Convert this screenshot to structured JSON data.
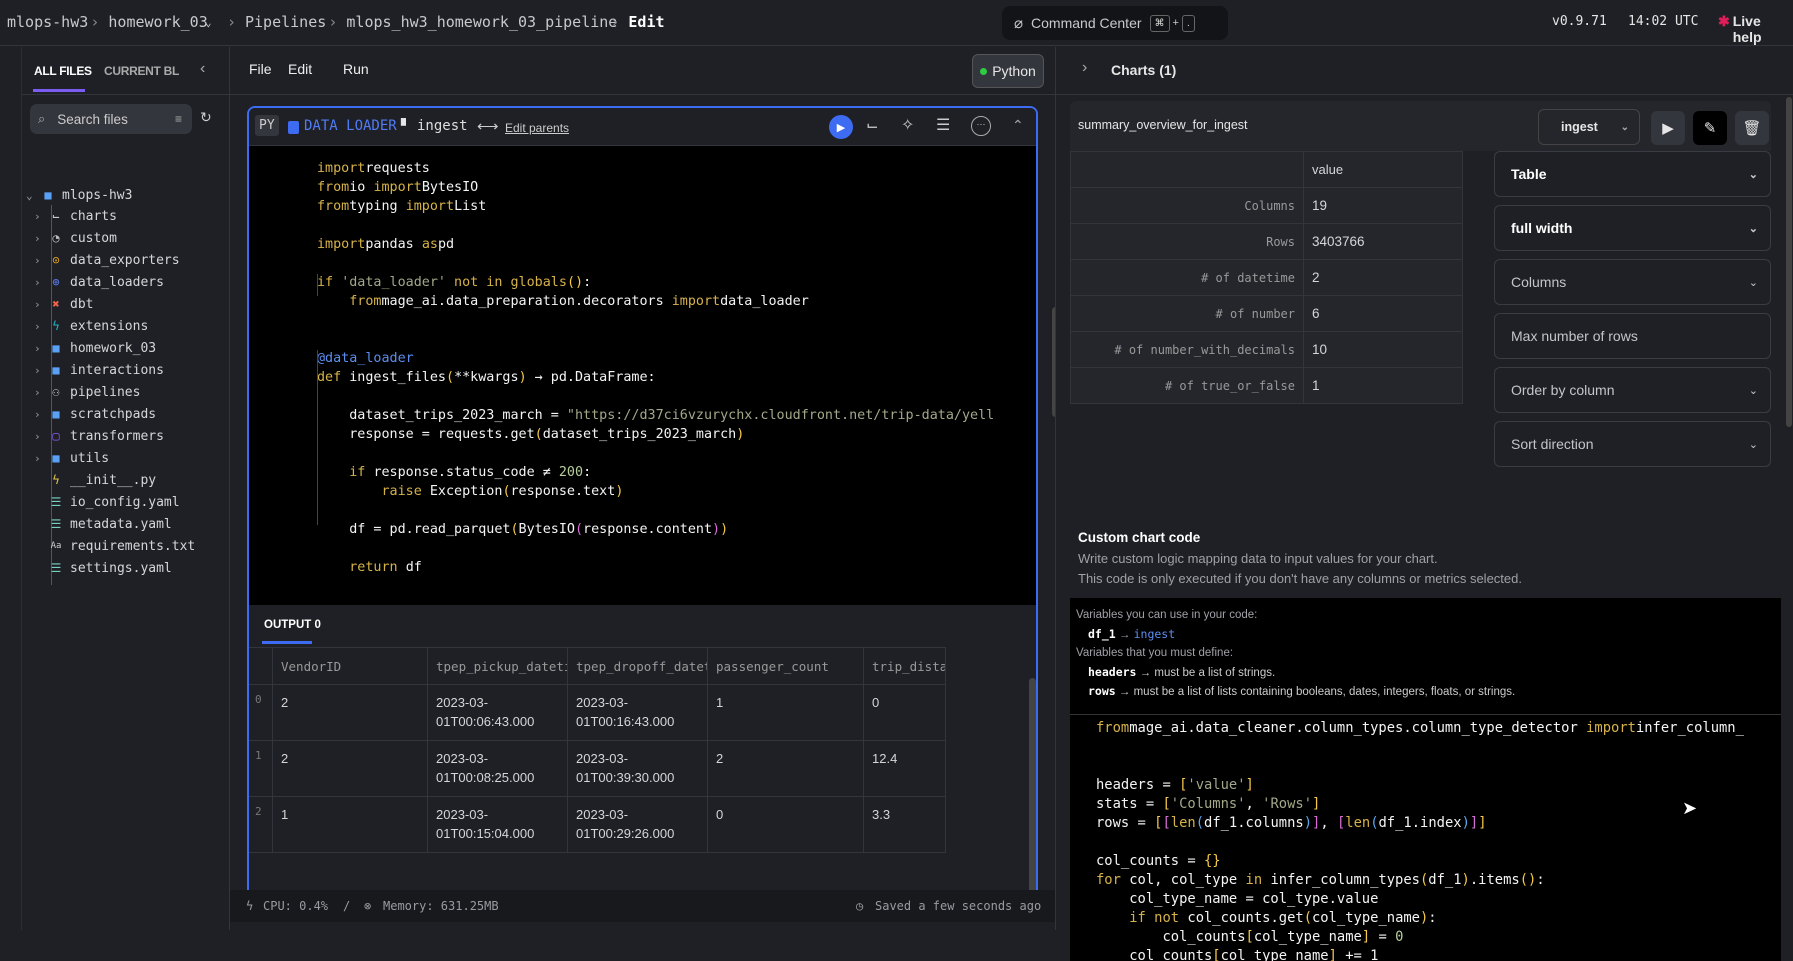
{
  "breadcrumb": [
    "mlops-hw3",
    "homework_03",
    "Pipelines",
    "mlops_hw3_homework_03_pipeline",
    "Edit"
  ],
  "command_center": {
    "label": "Command Center",
    "key1": "⌘",
    "plus": "+",
    "key2": "."
  },
  "version": "v0.9.71",
  "time": "14:02 UTC",
  "live_help": "Live help",
  "files": {
    "tabs": [
      "ALL FILES",
      "CURRENT BLOCK"
    ],
    "search_placeholder": "Search files",
    "root": "mlops-hw3",
    "items": [
      {
        "name": "charts",
        "icon": "chart-icon",
        "folder": true
      },
      {
        "name": "custom",
        "icon": "custom-icon",
        "folder": true
      },
      {
        "name": "data_exporters",
        "icon": "exporter-icon",
        "folder": true
      },
      {
        "name": "data_loaders",
        "icon": "loader-icon",
        "folder": true
      },
      {
        "name": "dbt",
        "icon": "dbt-icon",
        "folder": true
      },
      {
        "name": "extensions",
        "icon": "bolt-icon",
        "folder": true
      },
      {
        "name": "homework_03",
        "icon": "folder-icon",
        "folder": true
      },
      {
        "name": "interactions",
        "icon": "folder-icon",
        "folder": true
      },
      {
        "name": "pipelines",
        "icon": "pipeline-icon",
        "folder": true
      },
      {
        "name": "scratchpads",
        "icon": "folder-icon",
        "folder": true
      },
      {
        "name": "transformers",
        "icon": "transformer-icon",
        "folder": true
      },
      {
        "name": "utils",
        "icon": "folder-icon",
        "folder": true
      },
      {
        "name": "__init__.py",
        "icon": "python-icon",
        "folder": false
      },
      {
        "name": "io_config.yaml",
        "icon": "list-icon",
        "folder": false
      },
      {
        "name": "metadata.yaml",
        "icon": "list-icon",
        "folder": false
      },
      {
        "name": "requirements.txt",
        "icon": "text-icon",
        "folder": false
      },
      {
        "name": "settings.yaml",
        "icon": "list-icon",
        "folder": false
      }
    ]
  },
  "menu": [
    "File",
    "Edit",
    "Run"
  ],
  "kernel": "Python",
  "block": {
    "lang": "PY",
    "type": "DATA LOADER",
    "name": "ingest",
    "edit_parents": "Edit parents",
    "code": [
      [
        [
          "kw",
          "import"
        ],
        [
          "",
          "requests"
        ]
      ],
      [
        [
          "kw",
          "from"
        ],
        [
          "",
          "io "
        ],
        [
          "kw",
          "import"
        ],
        [
          "",
          "BytesIO"
        ]
      ],
      [
        [
          "kw",
          "from"
        ],
        [
          "",
          "typing "
        ],
        [
          "kw",
          "import"
        ],
        [
          "",
          "List"
        ]
      ],
      [],
      [
        [
          "kw",
          "import"
        ],
        [
          "",
          "pandas "
        ],
        [
          "kw",
          "as"
        ],
        [
          "",
          "pd"
        ]
      ],
      [],
      [
        [
          "kw",
          "if "
        ],
        [
          "str",
          "'data_loader'"
        ],
        [
          "kw",
          " not in "
        ],
        [
          "kw",
          "globals"
        ],
        [
          "br1",
          "()"
        ],
        [
          "",
          ":"
        ]
      ],
      [
        [
          "",
          "    "
        ],
        [
          "kw",
          "from"
        ],
        [
          "",
          "mage_ai.data_preparation.decorators "
        ],
        [
          "kw",
          "import"
        ],
        [
          "",
          "data_loader"
        ]
      ],
      [],
      [],
      [
        [
          "deco",
          "@data_loader"
        ]
      ],
      [
        [
          "kw",
          "def "
        ],
        [
          "",
          "ingest_files"
        ],
        [
          "br1",
          "("
        ],
        [
          "",
          "**kwargs"
        ],
        [
          "br1",
          ")"
        ],
        [
          "",
          "",
          " → pd.DataFrame:"
        ]
      ],
      [],
      [
        [
          "",
          "    dataset_trips_2023_march = "
        ],
        [
          "str",
          "\"https://d37ci6vzurychx.cloudfront.net/trip-data/yell"
        ]
      ],
      [
        [
          "",
          "    response = requests.get"
        ],
        [
          "br1",
          "("
        ],
        [
          "",
          "dataset_trips_2023_march"
        ],
        [
          "br1",
          ")"
        ]
      ],
      [],
      [
        [
          "",
          "    "
        ],
        [
          "kw",
          "if "
        ],
        [
          "",
          "response.status_code ≠ "
        ],
        [
          "num",
          "200"
        ],
        [
          "",
          ":"
        ]
      ],
      [
        [
          "",
          "        "
        ],
        [
          "kw",
          "raise "
        ],
        [
          "",
          "Exception"
        ],
        [
          "br1",
          "("
        ],
        [
          "",
          "response.text"
        ],
        [
          "br1",
          ")"
        ]
      ],
      [],
      [
        [
          "",
          "    df = pd.read_parquet"
        ],
        [
          "br1",
          "("
        ],
        [
          "",
          "BytesIO"
        ],
        [
          "br2",
          "("
        ],
        [
          "",
          "response.content"
        ],
        [
          "br2",
          ")"
        ],
        [
          "br1",
          ")"
        ]
      ],
      [],
      [
        [
          "",
          "    "
        ],
        [
          "kw",
          "return "
        ],
        [
          "",
          "df"
        ]
      ]
    ]
  },
  "output": {
    "tab": "OUTPUT 0",
    "columns": [
      "VendorID",
      "tpep_pickup_datetime",
      "tpep_dropoff_datetime",
      "passenger_count",
      "trip_distance"
    ],
    "rows": [
      {
        "index": "0",
        "cells": [
          "2",
          "2023-03-01T00:06:43.000",
          "2023-03-01T00:16:43.000",
          "1",
          "0"
        ]
      },
      {
        "index": "1",
        "cells": [
          "2",
          "2023-03-01T00:08:25.000",
          "2023-03-01T00:39:30.000",
          "2",
          "12.4"
        ]
      },
      {
        "index": "2",
        "cells": [
          "1",
          "2023-03-01T00:15:04.000",
          "2023-03-01T00:29:26.000",
          "0",
          "3.3"
        ]
      }
    ]
  },
  "status": {
    "cpu": "CPU: 0.4%",
    "divider": "/",
    "memory": "Memory: 631.25MB",
    "saved": "Saved a few seconds ago"
  },
  "charts": {
    "title": "Charts (1)",
    "chart_name": "summary_overview_for_ingest",
    "block_select": "ingest",
    "table": {
      "header": "value",
      "rows": [
        [
          "Columns",
          "19"
        ],
        [
          "Rows",
          "3403766"
        ],
        [
          "# of datetime",
          "2"
        ],
        [
          "# of number",
          "6"
        ],
        [
          "# of number_with_decimals",
          "10"
        ],
        [
          "# of true_or_false",
          "1"
        ]
      ]
    },
    "dropdowns": [
      {
        "label": "Table",
        "set": true,
        "arrow": true
      },
      {
        "label": "full width",
        "set": true,
        "arrow": true
      },
      {
        "label": "Columns",
        "set": false,
        "arrow": true
      },
      {
        "label": "Max number of rows",
        "set": false,
        "arrow": false
      },
      {
        "label": "Order by column",
        "set": false,
        "arrow": true
      },
      {
        "label": "Sort direction",
        "set": false,
        "arrow": true
      }
    ],
    "custom_title": "Custom chart code",
    "custom_desc1": "Write custom logic mapping data to input values for your chart.",
    "custom_desc2": "This code is only executed if you don't have any columns or metrics selected.",
    "vars_use": "Variables you can use in your code:",
    "var_df": "df_1",
    "var_df_val": "ingest",
    "vars_define": "Variables that you must define:",
    "var_headers": "headers",
    "var_headers_desc": "must be a list of strings.",
    "var_rows": "rows",
    "var_rows_desc": "must be a list of lists containing booleans, dates, integers, floats, or strings.",
    "code": [
      [
        [
          "kw",
          "from"
        ],
        [
          "",
          "mage_ai.data_cleaner.column_types.column_type_detector "
        ],
        [
          "kw",
          "import"
        ],
        [
          "",
          "infer_column_"
        ]
      ],
      [],
      [],
      [
        [
          "",
          "headers = "
        ],
        [
          "br1",
          "["
        ],
        [
          "str",
          "'value'"
        ],
        [
          "br1",
          "]"
        ]
      ],
      [
        [
          "",
          "stats = "
        ],
        [
          "br1",
          "["
        ],
        [
          "str",
          "'Columns'"
        ],
        [
          "",
          ", "
        ],
        [
          "str",
          "'Rows'"
        ],
        [
          "br1",
          "]"
        ]
      ],
      [
        [
          "",
          "rows = "
        ],
        [
          "br1",
          "["
        ],
        [
          "br2",
          "["
        ],
        [
          "kw",
          "len"
        ],
        [
          "br3",
          "("
        ],
        [
          "",
          "df_1.columns"
        ],
        [
          "br3",
          ")"
        ],
        [
          "br2",
          "]"
        ],
        [
          "",
          ", "
        ],
        [
          "br2",
          "["
        ],
        [
          "kw",
          "len"
        ],
        [
          "br3",
          "("
        ],
        [
          "",
          "df_1.index"
        ],
        [
          "br3",
          ")"
        ],
        [
          "br2",
          "]"
        ],
        [
          "br1",
          "]"
        ]
      ],
      [],
      [
        [
          "",
          "col_counts = "
        ],
        [
          "br1",
          "{}"
        ]
      ],
      [
        [
          "kw",
          "for "
        ],
        [
          "",
          "col, col_type "
        ],
        [
          "kw",
          "in "
        ],
        [
          "",
          "infer_column_types"
        ],
        [
          "br1",
          "("
        ],
        [
          "",
          "df_1"
        ],
        [
          "br1",
          ")"
        ],
        [
          "",
          ".items"
        ],
        [
          "br1",
          "()"
        ],
        [
          "",
          ":"
        ]
      ],
      [
        [
          "",
          "    col_type_name = col_type.value"
        ]
      ],
      [
        [
          "",
          "    "
        ],
        [
          "kw",
          "if not "
        ],
        [
          "",
          "col_counts.get"
        ],
        [
          "br1",
          "("
        ],
        [
          "",
          "col_type_name"
        ],
        [
          "br1",
          ")"
        ],
        [
          "",
          ":"
        ]
      ],
      [
        [
          "",
          "        col_counts"
        ],
        [
          "br1",
          "["
        ],
        [
          "",
          "col_type_name"
        ],
        [
          "br1",
          "]"
        ],
        [
          "",
          "",
          " = "
        ],
        [
          "num",
          "0"
        ]
      ],
      [
        [
          "",
          "    col_counts"
        ],
        [
          "br1",
          "["
        ],
        [
          "",
          "col_type_name"
        ],
        [
          "br1",
          "]"
        ],
        [
          "",
          "",
          " += 1"
        ]
      ]
    ]
  }
}
